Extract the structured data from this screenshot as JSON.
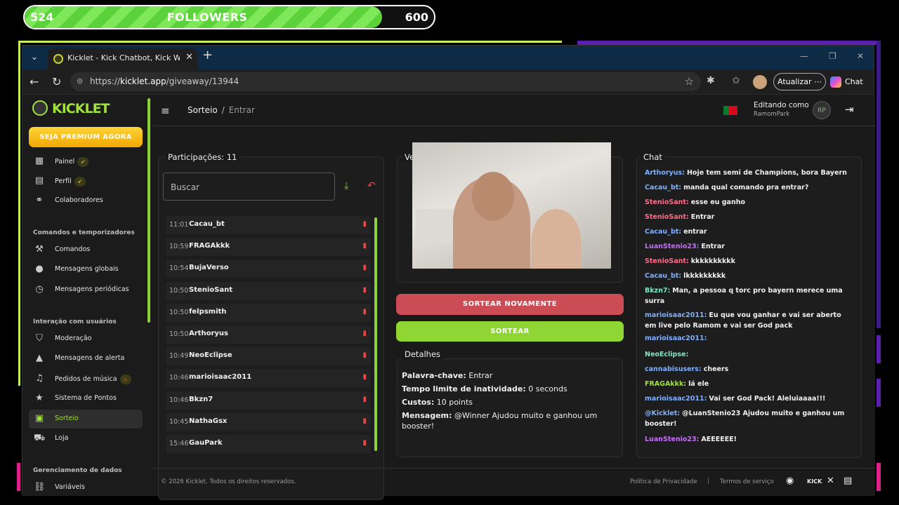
{
  "overlay": {
    "followers_current": "524",
    "followers_label": "FOLLOWERS",
    "followers_goal": "600",
    "progress_fraction": 0.873
  },
  "browser": {
    "tab_title": "Kicklet - Kick Chatbot, Kick Widget",
    "url_scheme": "https://",
    "url_host": "kicklet.app",
    "url_path": "/giveaway/13944",
    "update_label": "Atualizar",
    "chat_label": "Chat"
  },
  "brand": {
    "name": "KICKLET",
    "accent": "#9fe03a"
  },
  "sidebar": {
    "premium_label": "SEJA PREMIUM AGORA",
    "group1": [
      {
        "label": "Painel",
        "icon": "dashboard-icon",
        "badge": "rocket-icon"
      },
      {
        "label": "Perfil",
        "icon": "profile-icon",
        "badge": "rocket-icon"
      },
      {
        "label": "Colaboradores",
        "icon": "collaborators-icon"
      }
    ],
    "section_commands": "Comandos e temporizadores",
    "group2": [
      {
        "label": "Comandos",
        "icon": "hammer-icon"
      },
      {
        "label": "Mensagens globais",
        "icon": "chat-bubble-icon"
      },
      {
        "label": "Mensagens periódicas",
        "icon": "clock-icon"
      }
    ],
    "section_interaction": "Interação com usuários",
    "group3": [
      {
        "label": "Moderação",
        "icon": "shield-icon"
      },
      {
        "label": "Mensagens de alerta",
        "icon": "warning-icon"
      },
      {
        "label": "Pedidos de música",
        "icon": "music-icon",
        "badge": "fire-icon"
      },
      {
        "label": "Sistema de Pontos",
        "icon": "star-icon"
      },
      {
        "label": "Sorteio",
        "icon": "gift-icon",
        "active": true
      },
      {
        "label": "Loja",
        "icon": "cart-icon"
      }
    ],
    "section_data": "Gerenciamento de dados",
    "group4": [
      {
        "label": "Variáveis",
        "icon": "link-icon"
      }
    ]
  },
  "topbar": {
    "crumb_root": "Sorteio",
    "crumb_sep": "/",
    "crumb_current": "Entrar",
    "editing_label": "Editando como",
    "editing_user": "RamomPark",
    "avatar_text": "RP"
  },
  "participants": {
    "title": "Participações: 11",
    "search_placeholder": "Buscar",
    "rows": [
      {
        "time": "11:01",
        "name": "Cacau_bt"
      },
      {
        "time": "10:59",
        "name": "FRAGAkkk"
      },
      {
        "time": "10:54",
        "name": "BujaVerso"
      },
      {
        "time": "10:50",
        "name": "StenioSant"
      },
      {
        "time": "10:50",
        "name": "felpsmith"
      },
      {
        "time": "10:50",
        "name": "Arthoryus"
      },
      {
        "time": "10:49",
        "name": "NeoEclipse"
      },
      {
        "time": "10:46",
        "name": "marioisaac2011"
      },
      {
        "time": "10:46",
        "name": "Bkzn7"
      },
      {
        "time": "10:45",
        "name": "NathaGsx"
      },
      {
        "time": "15:46",
        "name": "GauPark"
      }
    ]
  },
  "winners": {
    "title_partial": "Ve"
  },
  "actions": {
    "draw_again": "SORTEAR NOVAMENTE",
    "draw": "SORTEAR"
  },
  "details": {
    "title": "Detalhes",
    "keyword_label": "Palavra-chave:",
    "keyword_value": "Entrar",
    "inactivity_label": "Tempo limite de inatividade:",
    "inactivity_value": "0 seconds",
    "cost_label": "Custos:",
    "cost_value": "10 points",
    "message_label": "Mensagem:",
    "message_value": "@Winner Ajudou muito e ganhou um booster!"
  },
  "chat": {
    "title": "Chat",
    "messages": [
      {
        "user": "Arthoryus:",
        "text": "Hoje tem semi de Champions, bora Bayern",
        "color": "#7fb0ff"
      },
      {
        "user": "Cacau_bt:",
        "text": "manda qual comando pra entrar?",
        "color": "#7fb0ff"
      },
      {
        "user": "StenioSant:",
        "text": "esse eu ganho",
        "color": "#ff6b8a"
      },
      {
        "user": "StenioSant:",
        "text": "Entrar",
        "color": "#ff6b8a"
      },
      {
        "user": "Cacau_bt:",
        "text": "entrar",
        "color": "#7fb0ff"
      },
      {
        "user": "LuanStenio23:",
        "text": "Entrar",
        "color": "#c86bff"
      },
      {
        "user": "StenioSant:",
        "text": "kkkkkkkkkk",
        "color": "#ff6b8a"
      },
      {
        "user": "Cacau_bt:",
        "text": "lkkkkkkkkk",
        "color": "#7fb0ff"
      },
      {
        "user": "Bkzn7:",
        "text": "Man, a pessoa q torc pro bayern merece uma surra",
        "color": "#7ee8c0"
      },
      {
        "user": "marioisaac2011:",
        "text": "Eu que vou ganhar e vai ser aberto em live pelo Ramom e vai ser God pack",
        "color": "#7fb0ff"
      },
      {
        "user": "marioisaac2011:",
        "text": "",
        "color": "#7fb0ff"
      },
      {
        "user": "NeoEclipse:",
        "text": "",
        "color": "#7ee8c0"
      },
      {
        "user": "cannabisusers:",
        "text": "cheers",
        "color": "#7fb0ff"
      },
      {
        "user": "FRAGAkkk:",
        "text": "lá ele",
        "color": "#9fe03a"
      },
      {
        "user": "marioisaac2011:",
        "text": "Vai ser God Pack! Aleluiaaaa!!!",
        "color": "#7fb0ff"
      },
      {
        "user": "@Kicklet:",
        "text": "@LuanStenio23 Ajudou muito e ganhou um booster!",
        "color": "#7fb0ff"
      },
      {
        "user": "LuanStenio23:",
        "text": "AEEEEEE!",
        "color": "#c86bff"
      }
    ]
  },
  "footer": {
    "copyright": "© 2026 Kicklet. Todos os direitos reservados.",
    "privacy": "Política de Privacidade",
    "sep": "|",
    "terms": "Termos de serviço",
    "kick_label": "KICK"
  }
}
